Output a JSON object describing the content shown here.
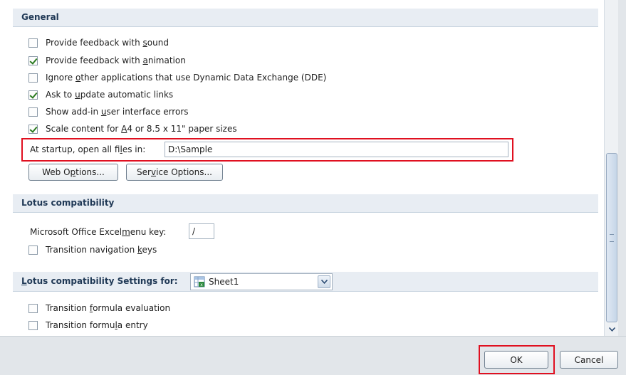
{
  "general": {
    "header": "General",
    "options": [
      {
        "pre": "Provide feedback with ",
        "u": "s",
        "post": "ound",
        "checked": false
      },
      {
        "pre": "Provide feedback with ",
        "u": "a",
        "post": "nimation",
        "checked": true
      },
      {
        "pre": "Ignore ",
        "u": "o",
        "post": "ther applications that use Dynamic Data Exchange (DDE)",
        "checked": false
      },
      {
        "pre": "Ask to ",
        "u": "u",
        "post": "pdate automatic links",
        "checked": true
      },
      {
        "pre": "Show add-in ",
        "u": "u",
        "post": "ser interface errors",
        "checked": false
      },
      {
        "pre": "Scale content for ",
        "u": "A",
        "post": "4 or 8.5 x 11\" paper sizes",
        "checked": true
      }
    ],
    "startup": {
      "pre": "At startup, open all fi",
      "u": "l",
      "post": "es in:",
      "value": "D:\\Sample"
    },
    "web_options": {
      "pre": "Web O",
      "u": "p",
      "post": "tions..."
    },
    "service_options": {
      "pre": "Ser",
      "u": "v",
      "post": "ice Options..."
    }
  },
  "lotus": {
    "header": "Lotus compatibility",
    "menu_key": {
      "pre": "Microsoft Office Excel ",
      "u": "m",
      "post": "enu key:",
      "value": "/"
    },
    "transition_nav": {
      "pre": "Transition navigation ",
      "u": "k",
      "post": "eys",
      "checked": false
    }
  },
  "lotus_settings": {
    "header_pre": "",
    "header_u": "L",
    "header_post": "otus compatibility Settings for:",
    "sheet": "Sheet1",
    "formula_eval": {
      "pre": "Transition ",
      "u": "f",
      "post": "ormula evaluation",
      "checked": false
    },
    "formula_entry": {
      "pre": "Transition formu",
      "u": "l",
      "post": "a entry",
      "checked": false
    }
  },
  "footer": {
    "ok": "OK",
    "cancel": "Cancel"
  },
  "colors": {
    "highlight": "#e01020",
    "section": "#e8edf3",
    "footer": "#e2e6ea"
  },
  "icons": {
    "sheet": "excel-sheet-icon",
    "dropdown": "chevron-down-icon"
  }
}
